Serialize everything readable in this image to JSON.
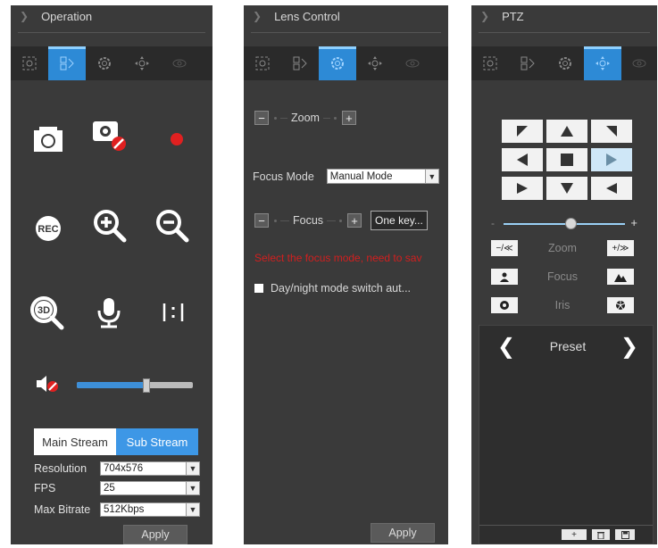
{
  "operation": {
    "title": "Operation",
    "tabs": [
      "capture-tab-icon",
      "operation-tab-icon",
      "lens-tab-icon",
      "ptz-tab-icon",
      "eye-tab-icon"
    ],
    "active_tab": 1,
    "buttons": [
      "camera-icon",
      "privacy-off-icon",
      "record-dot-icon",
      "rec-icon",
      "zoom-in-icon",
      "zoom-out-icon",
      "3d-zoom-icon",
      "microphone-icon",
      "aspect-ratio-icon"
    ],
    "volume_level": 0.6,
    "streams": {
      "main": "Main Stream",
      "sub": "Sub Stream",
      "active": "sub"
    },
    "resolution_label": "Resolution",
    "resolution_value": "704x576",
    "fps_label": "FPS",
    "fps_value": "25",
    "bitrate_label": "Max Bitrate",
    "bitrate_value": "512Kbps",
    "apply": "Apply"
  },
  "lens": {
    "title": "Lens Control",
    "zoom_label": "Zoom",
    "focus_mode_label": "Focus Mode",
    "focus_mode_value": "Manual Mode",
    "focus_label": "Focus",
    "one_key": "One key...",
    "warning": "Select the focus mode, need to sav",
    "daynight": "Day/night mode switch aut...",
    "apply": "Apply"
  },
  "ptz": {
    "title": "PTZ",
    "zoom": "Zoom",
    "focus": "Focus",
    "iris": "Iris",
    "speed_level": 0.55,
    "preset": "Preset",
    "colors": {
      "accent": "#2d8ad6",
      "panel": "#3a3a3a",
      "red": "#e02020"
    }
  }
}
